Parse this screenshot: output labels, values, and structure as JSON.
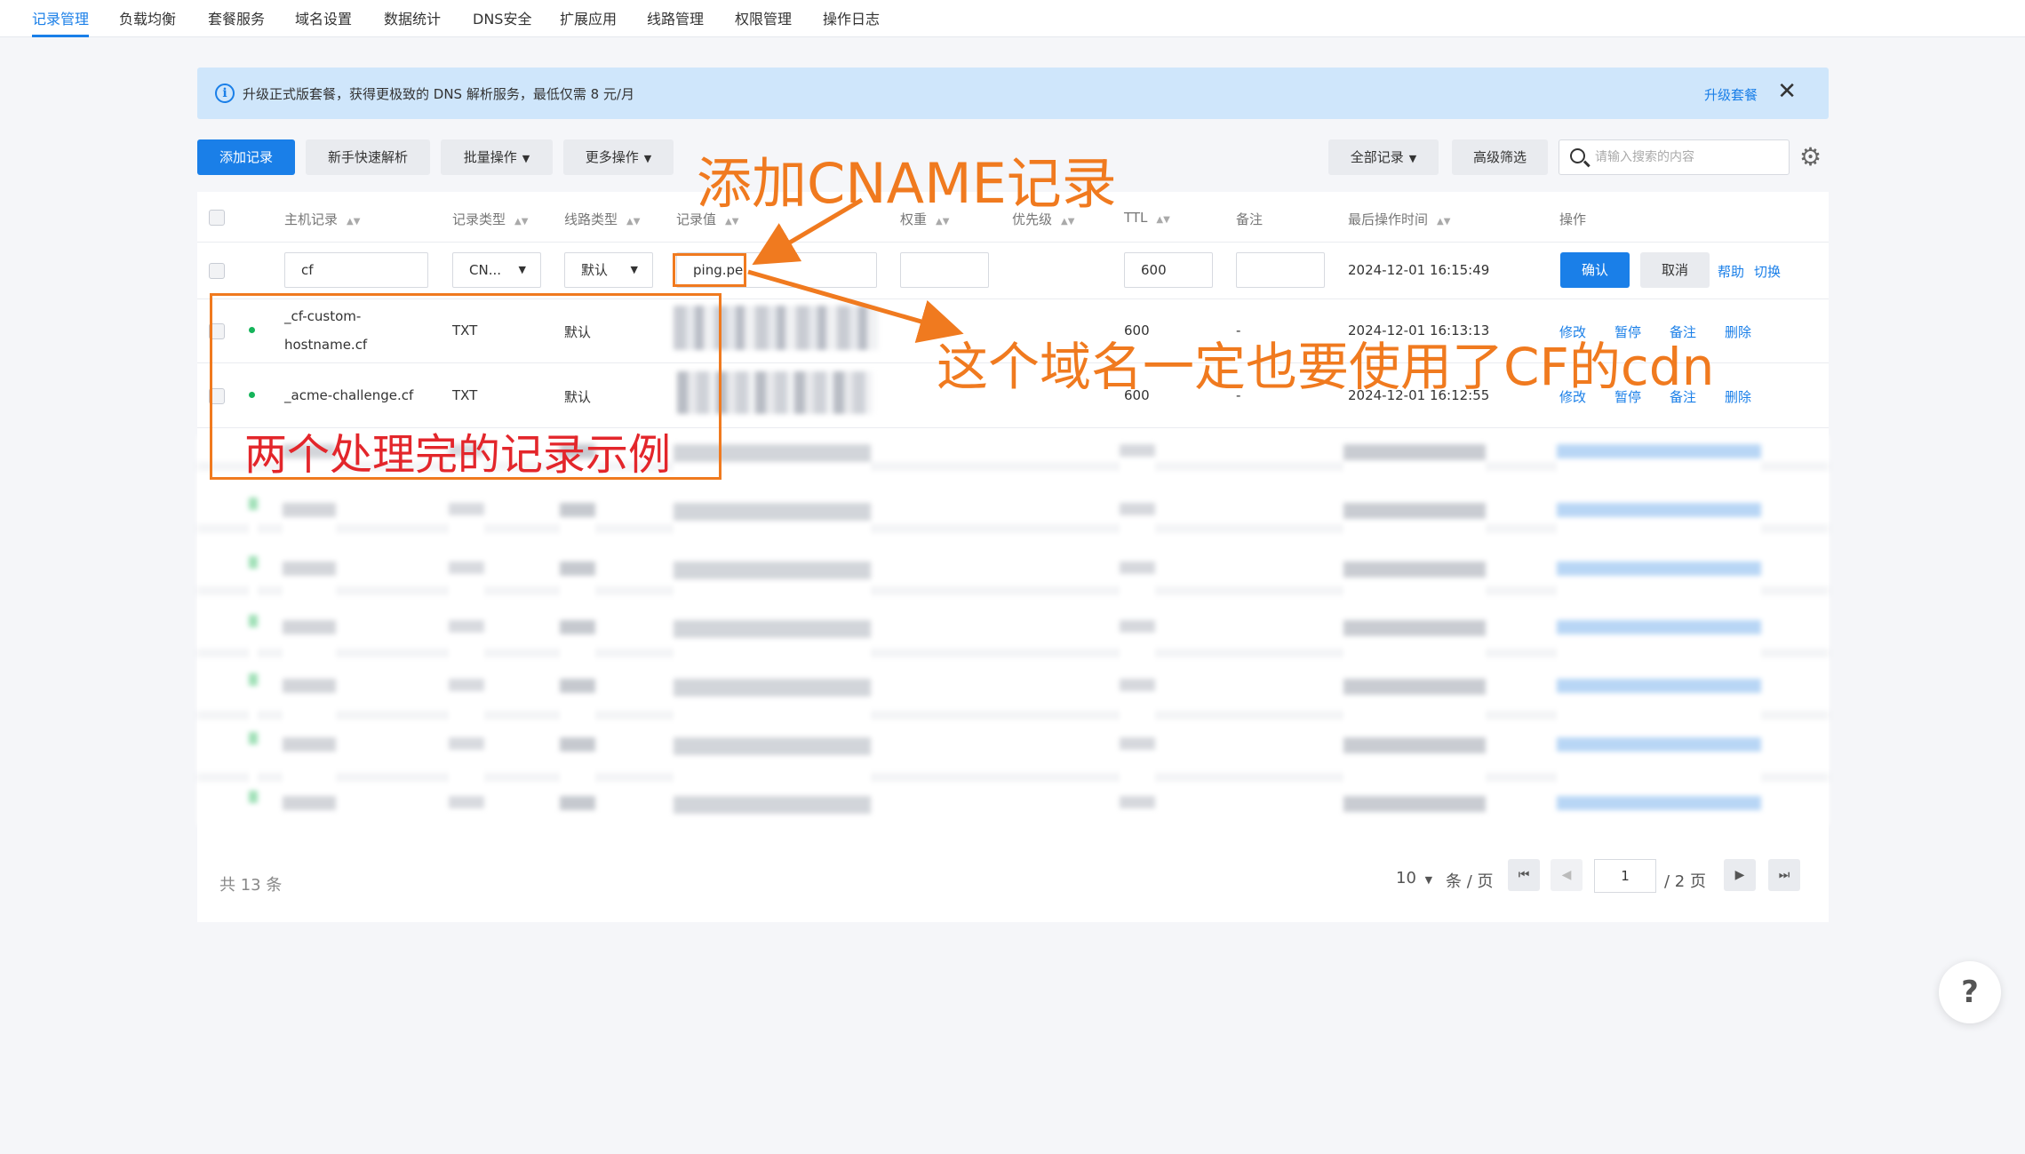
{
  "tabs": [
    "记录管理",
    "负载均衡",
    "套餐服务",
    "域名设置",
    "数据统计",
    "DNS安全",
    "扩展应用",
    "线路管理",
    "权限管理",
    "操作日志"
  ],
  "banner": {
    "icon": "info-icon",
    "message": "升级正式版套餐，获得更极致的 DNS 解析服务，最低仅需 8 元/月",
    "action": "升级套餐"
  },
  "toolbar": {
    "add": "添加记录",
    "quick": "新手快速解析",
    "batch": "批量操作",
    "more": "更多操作",
    "all_records": "全部记录",
    "advanced_filter": "高级筛选",
    "search_placeholder": "请输入搜索的内容"
  },
  "table": {
    "headers": {
      "host": "主机记录",
      "type": "记录类型",
      "line": "线路类型",
      "value": "记录值",
      "weight": "权重",
      "priority": "优先级",
      "ttl": "TTL",
      "remark": "备注",
      "last_op": "最后操作时间",
      "action": "操作"
    },
    "edit_row": {
      "host": "cf",
      "type": "CN...",
      "line": "默认",
      "value": "ping.pe",
      "ttl": "600",
      "time": "2024-12-01 16:15:49",
      "confirm": "确认",
      "cancel": "取消",
      "help": "帮助",
      "switch": "切换"
    },
    "rows": [
      {
        "host_line1": "_cf-custom-",
        "host_line2": "hostname.cf",
        "type": "TXT",
        "line": "默认",
        "ttl": "600",
        "remark": "-",
        "time": "2024-12-01 16:13:13",
        "actions": [
          "修改",
          "暂停",
          "备注",
          "删除"
        ]
      },
      {
        "host_line1": "_acme-challenge.cf",
        "type": "TXT",
        "line": "默认",
        "ttl": "600",
        "remark": "-",
        "time": "2024-12-01 16:12:55",
        "actions": [
          "修改",
          "暂停",
          "备注",
          "删除"
        ]
      }
    ]
  },
  "pagination": {
    "total": "共 13 条",
    "per_page": "10",
    "per_page_unit": "条 / 页",
    "current": "1",
    "pages": "/ 2 页"
  },
  "help_label": "?",
  "annotations": {
    "add_cname": "添加CNAME记录",
    "domain_cdn": "这个域名一定也要使用了CF的cdn",
    "two_examples": "两个处理完的记录示例"
  },
  "colors": {
    "primary": "#1a7fe8",
    "banner_bg": "#cfe6fb",
    "annotation_orange": "#f07a1f",
    "annotation_red": "#e3262b",
    "status_green": "#15b45a"
  }
}
